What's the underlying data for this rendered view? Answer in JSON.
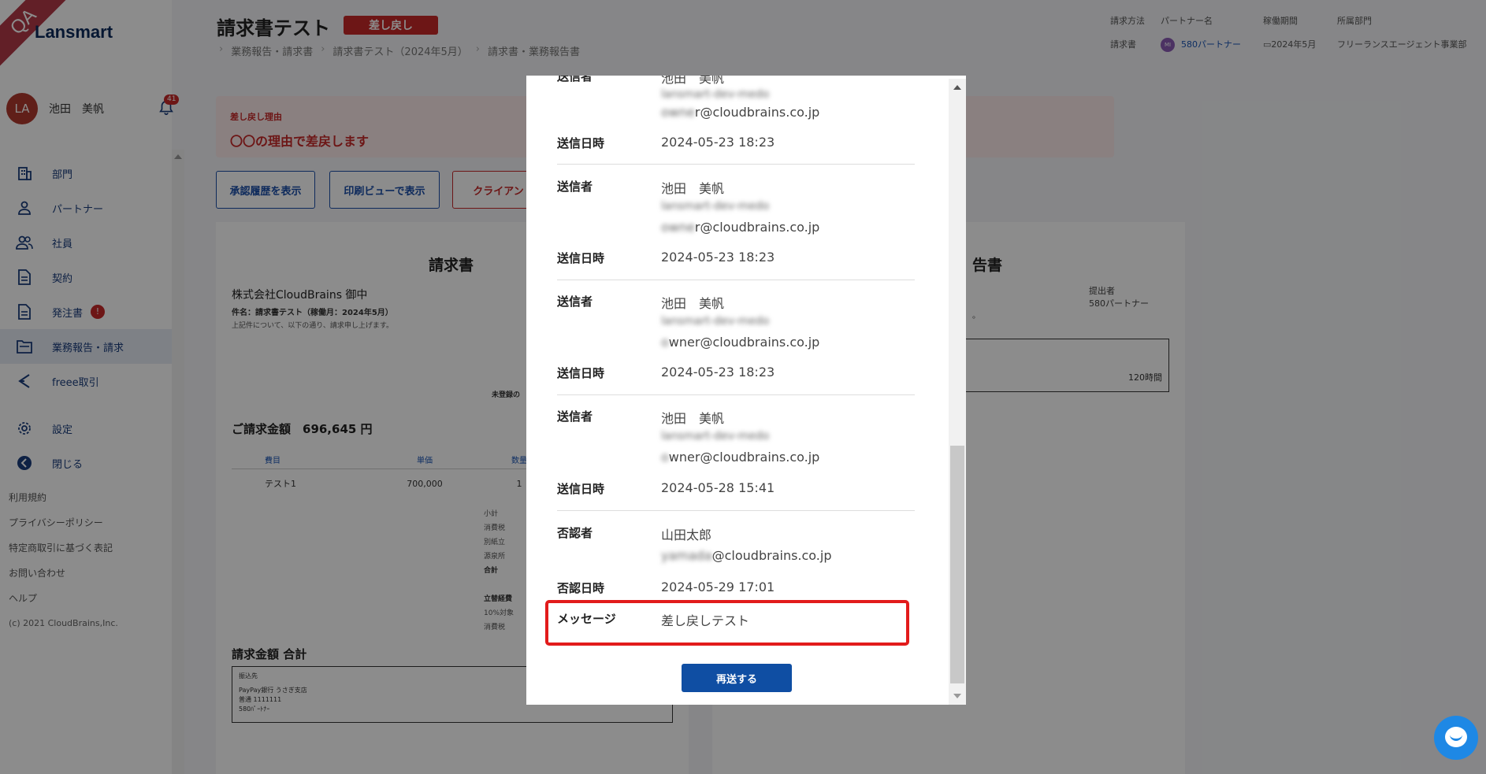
{
  "sidebar": {
    "ribbon": "QA",
    "logo": "Lansmart",
    "user": {
      "initials": "LA",
      "name": "池田　美帆",
      "notification_count": "41"
    },
    "items": [
      {
        "label": "部門",
        "icon": "building-icon"
      },
      {
        "label": "パートナー",
        "icon": "person-icon"
      },
      {
        "label": "社員",
        "icon": "people-icon"
      },
      {
        "label": "契約",
        "icon": "document-icon"
      },
      {
        "label": "発注書",
        "icon": "order-document-icon",
        "badge": "!"
      },
      {
        "label": "業務報告・請求",
        "icon": "folder-icon",
        "active": true
      },
      {
        "label": "freee取引",
        "icon": "freee-icon"
      },
      {
        "label": "設定",
        "icon": "gear-icon"
      },
      {
        "label": "閉じる",
        "icon": "back-circle-icon"
      }
    ],
    "footer": [
      "利用規約",
      "プライバシーポリシー",
      "特定商取引に基づく表記",
      "お問い合わせ",
      "ヘルプ"
    ],
    "copyright": "(c) 2021 CloudBrains,Inc."
  },
  "header": {
    "title": "請求書テスト",
    "status": "差し戻し",
    "breadcrumb": [
      "業務報告・請求書",
      "請求書テスト（2024年5月）",
      "請求書・業務報告書"
    ],
    "meta_labels": [
      "請求方法",
      "パートナー名",
      "稼働期間",
      "所属部門"
    ],
    "meta_values": {
      "method": "請求書",
      "partner_initials": "MI",
      "partner": "580パートナー",
      "period": "2024年5月",
      "department": "フリーランスエージェント事業部"
    }
  },
  "reason": {
    "label": "差し戻し理由",
    "text": "〇〇の理由で差戻します"
  },
  "buttons": {
    "history": "承認履歴を表示",
    "print": "印刷ビューで表示",
    "client": "クライアント"
  },
  "invoice": {
    "title": "請求書",
    "customer": "株式会社CloudBrains 御中",
    "subject": "件名：請求書テスト（稼働月：2024年5月）",
    "note": "上記件について、以下の通り、請求申し上げます。",
    "unregistered": "未登録の",
    "total_label": "ご請求金額　696,645 円",
    "columns": [
      "費目",
      "単価",
      "数量"
    ],
    "rows": [
      {
        "item": "テスト1",
        "price": "700,000",
        "qty": "1"
      }
    ],
    "sums": [
      "小計",
      "消費税",
      "別紙立",
      "源泉所",
      "合計"
    ],
    "sums2": [
      "立替経費",
      "10%対象",
      "消費税"
    ],
    "grand_label": "請求金額 合計",
    "bank": [
      "振込先",
      "PayPay銀行 うさぎ支店",
      "普通 1111111",
      "580ﾊﾟｰﾄﾅｰ"
    ]
  },
  "report": {
    "title_fragment": "告書",
    "submitter_label": "提出者",
    "submitter": "580パートナー",
    "hours": "120時間",
    "dot": "。"
  },
  "modal": {
    "records": [
      {
        "sender_label": "送信者",
        "name": "池田　美帆",
        "email_suffix": "r@cloudbrains.co.jp",
        "blur_line": "lansmart-dev-medo",
        "email_prefix": "owne",
        "date_label": "送信日時",
        "date": "2024-05-23 18:23"
      },
      {
        "sender_label": "送信者",
        "name": "池田　美帆",
        "blur_line": "lansmart-dev-medo",
        "email_prefix": "owne",
        "email_suffix": "r@cloudbrains.co.jp",
        "date_label": "送信日時",
        "date": "2024-05-23 18:23"
      },
      {
        "sender_label": "送信者",
        "name": "池田　美帆",
        "blur_line": "lansmart-dev-medo",
        "email_prefix": "o",
        "email_suffix": "wner@cloudbrains.co.jp",
        "date_label": "送信日時",
        "date": "2024-05-23 18:23"
      },
      {
        "sender_label": "送信者",
        "name": "池田　美帆",
        "blur_line": "lansmart-dev-medo",
        "email_prefix": "o",
        "email_suffix": "wner@cloudbrains.co.jp",
        "date_label": "送信日時",
        "date": "2024-05-28 15:41"
      }
    ],
    "rejector_label": "否認者",
    "rejector_name": "山田太郎",
    "rejector_email_prefix": "yamada",
    "rejector_email_suffix": "@cloudbrains.co.jp",
    "reject_date_label": "否認日時",
    "reject_date": "2024-05-29 17:01",
    "message_label": "メッセージ",
    "message": "差し戻しテスト",
    "resend": "再送する"
  }
}
